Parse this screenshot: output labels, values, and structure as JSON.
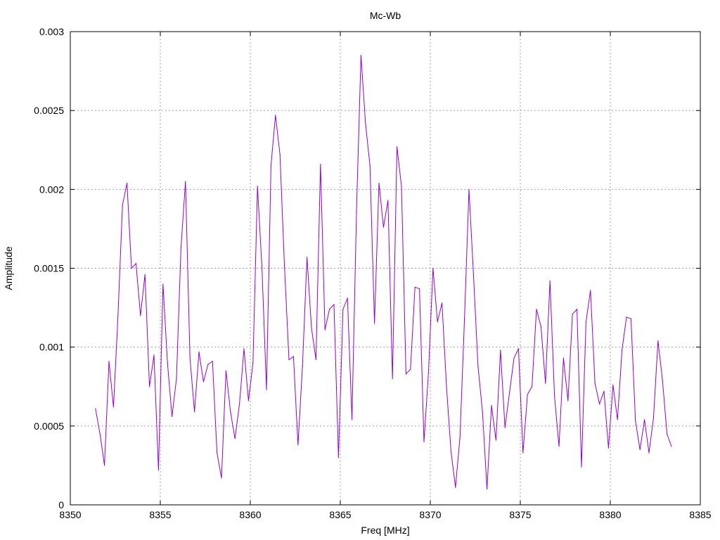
{
  "chart_data": {
    "type": "line",
    "title": "Mc-Wb",
    "xlabel": "Freq [MHz]",
    "ylabel": "Amplitude",
    "xlim": [
      8350,
      8385
    ],
    "ylim": [
      0,
      0.003
    ],
    "xticks": [
      "8350",
      "8355",
      "8360",
      "8365",
      "8370",
      "8375",
      "8380",
      "8385"
    ],
    "yticks": [
      "0",
      "0.0005",
      "0.001",
      "0.0015",
      "0.002",
      "0.0025",
      "0.003"
    ],
    "grid": true,
    "series": [
      {
        "color": "#9400d3",
        "x": [
          8351.4,
          8351.65,
          8351.9,
          8352.15,
          8352.4,
          8352.65,
          8352.9,
          8353.15,
          8353.4,
          8353.65,
          8353.9,
          8354.15,
          8354.4,
          8354.65,
          8354.9,
          8355.15,
          8355.4,
          8355.65,
          8355.9,
          8356.15,
          8356.4,
          8356.65,
          8356.9,
          8357.15,
          8357.4,
          8357.65,
          8357.9,
          8358.15,
          8358.4,
          8358.65,
          8358.9,
          8359.15,
          8359.4,
          8359.65,
          8359.9,
          8360.15,
          8360.4,
          8360.65,
          8360.9,
          8361.15,
          8361.4,
          8361.65,
          8361.9,
          8362.15,
          8362.4,
          8362.65,
          8362.9,
          8363.15,
          8363.4,
          8363.65,
          8363.9,
          8364.15,
          8364.4,
          8364.65,
          8364.9,
          8365.15,
          8365.4,
          8365.65,
          8365.9,
          8366.15,
          8366.4,
          8366.65,
          8366.9,
          8367.15,
          8367.4,
          8367.65,
          8367.9,
          8368.15,
          8368.4,
          8368.65,
          8368.9,
          8369.15,
          8369.4,
          8369.65,
          8369.9,
          8370.15,
          8370.4,
          8370.65,
          8370.9,
          8371.15,
          8371.4,
          8371.65,
          8371.9,
          8372.15,
          8372.4,
          8372.65,
          8372.9,
          8373.15,
          8373.4,
          8373.65,
          8373.9,
          8374.15,
          8374.4,
          8374.65,
          8374.9,
          8375.15,
          8375.4,
          8375.65,
          8375.9,
          8376.15,
          8376.4,
          8376.65,
          8376.9,
          8377.15,
          8377.4,
          8377.65,
          8377.9,
          8378.15,
          8378.4,
          8378.65,
          8378.9,
          8379.15,
          8379.4,
          8379.65,
          8379.9,
          8380.15,
          8380.4,
          8380.65,
          8380.9,
          8381.15,
          8381.4,
          8381.65,
          8381.9,
          8382.15,
          8382.4,
          8382.65,
          8382.9,
          8383.15,
          8383.4
        ],
        "y": [
          0.00061,
          0.00045,
          0.00025,
          0.00091,
          0.00062,
          0.0012,
          0.0019,
          0.00204,
          0.0015,
          0.00153,
          0.0012,
          0.00146,
          0.00075,
          0.00095,
          0.00022,
          0.0014,
          0.0009,
          0.00056,
          0.0008,
          0.00163,
          0.00205,
          0.00093,
          0.00059,
          0.00097,
          0.00078,
          0.00089,
          0.00091,
          0.00033,
          0.00017,
          0.00085,
          0.00059,
          0.00042,
          0.00064,
          0.00099,
          0.00066,
          0.0009,
          0.00202,
          0.0015,
          0.00073,
          0.00215,
          0.00247,
          0.00222,
          0.00151,
          0.00092,
          0.00094,
          0.00038,
          0.00088,
          0.00157,
          0.00112,
          0.00092,
          0.00216,
          0.00111,
          0.00124,
          0.00127,
          0.0003,
          0.00124,
          0.00131,
          0.00054,
          0.00186,
          0.00285,
          0.00242,
          0.00215,
          0.00115,
          0.00204,
          0.00176,
          0.00193,
          0.0008,
          0.00227,
          0.00202,
          0.00083,
          0.00086,
          0.00138,
          0.00137,
          0.0004,
          0.00084,
          0.0015,
          0.00116,
          0.00128,
          0.00075,
          0.00034,
          0.00011,
          0.00043,
          0.00118,
          0.002,
          0.00146,
          0.00088,
          0.00059,
          0.0001,
          0.00063,
          0.00041,
          0.00098,
          0.00049,
          0.00071,
          0.00093,
          0.00099,
          0.00033,
          0.0007,
          0.00075,
          0.00124,
          0.00113,
          0.00077,
          0.00142,
          0.00069,
          0.00037,
          0.00093,
          0.00066,
          0.00121,
          0.00124,
          0.00024,
          0.00116,
          0.00136,
          0.00077,
          0.00064,
          0.00072,
          0.00036,
          0.00076,
          0.00054,
          0.00098,
          0.00119,
          0.00118,
          0.00053,
          0.00035,
          0.00054,
          0.00033,
          0.00055,
          0.00104,
          0.00079,
          0.00045,
          0.00037
        ]
      }
    ]
  }
}
